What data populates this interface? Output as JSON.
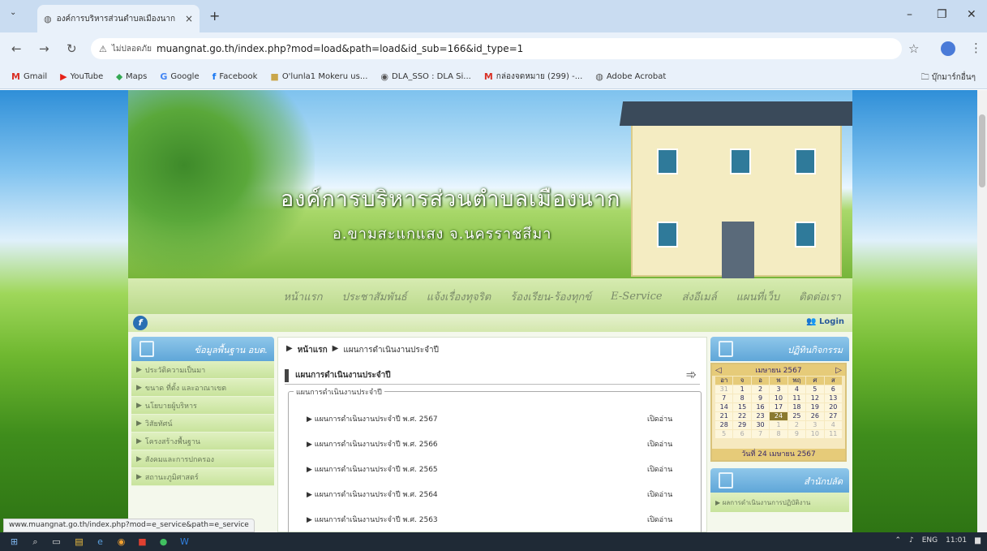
{
  "browser": {
    "tab_title": "องค์การบริหารส่วนตำบลเมืองนาก",
    "not_secure_label": "ไม่ปลอดภัย",
    "url": "muangnat.go.th/index.php?mod=load&path=load&id_sub=166&id_type=1",
    "bookmarks": [
      {
        "icon": "gmail-icon",
        "glyph": "M",
        "label": "Gmail",
        "color": "#d93025"
      },
      {
        "icon": "youtube-icon",
        "glyph": "▶",
        "label": "YouTube",
        "color": "#e62117"
      },
      {
        "icon": "maps-icon",
        "glyph": "⬥",
        "label": "Maps",
        "color": "#34a853"
      },
      {
        "icon": "google-icon",
        "glyph": "G",
        "label": "Google",
        "color": "#4285f4"
      },
      {
        "icon": "facebook-icon",
        "glyph": "f",
        "label": "Facebook",
        "color": "#1877f2"
      },
      {
        "icon": "folder-icon",
        "glyph": "■",
        "label": "O'lunla1 Mokeru us...",
        "color": "#c9a64a"
      },
      {
        "icon": "dla-icon",
        "glyph": "◉",
        "label": "DLA_SSO : DLA Si...",
        "color": "#555555"
      },
      {
        "icon": "gmail-icon",
        "glyph": "M",
        "label": "กล่องจดหมาย (299) -...",
        "color": "#d93025"
      },
      {
        "icon": "globe-icon",
        "glyph": "◍",
        "label": "Adobe Acrobat",
        "color": "#555555"
      }
    ],
    "other_bookmarks": "บุ๊กมาร์กอื่นๆ"
  },
  "site": {
    "title": "องค์การบริหารส่วนตำบลเมืองนาก",
    "subtitle": "อ.ขามสะแกแสง จ.นครราชสีมา",
    "menu": [
      "หน้าแรก",
      "ประชาสัมพันธ์",
      "แจ้งเรื่องทุจริต",
      "ร้องเรียน-ร้องทุกข์",
      "E-Service",
      "ส่งอีเมล์",
      "แผนที่เว็บ",
      "ติดต่อเรา"
    ],
    "login": "Login"
  },
  "left": {
    "title": "ข้อมูลพื้นฐาน อบต.",
    "items": [
      "ประวัติความเป็นมา",
      "ขนาด ที่ตั้ง และอาณาเขต",
      "นโยบายผู้บริหาร",
      "วิสัยทัศน์",
      "โครงสร้างพื้นฐาน",
      "สังคมและการปกครอง",
      "สถานะภูมิศาสตร์"
    ]
  },
  "center": {
    "breadcrumb_home": "หน้าแรก",
    "breadcrumb_current": "แผนการดำเนินงานประจำปี",
    "section_title": "แผนการดำเนินงานประจำปี",
    "fieldset_legend": "แผนการดำเนินงานประจำปี",
    "read_label": "เปิดอ่าน",
    "plans": [
      "แผนการดำเนินงานประจำปี พ.ศ. 2567",
      "แผนการดำเนินงานประจำปี พ.ศ. 2566",
      "แผนการดำเนินงานประจำปี พ.ศ. 2565",
      "แผนการดำเนินงานประจำปี พ.ศ. 2564",
      "แผนการดำเนินงานประจำปี พ.ศ. 2563"
    ]
  },
  "right": {
    "calendar_title": "ปฏิทินกิจกรรม",
    "month_label": "เมษายน 2567",
    "dow": [
      "อา",
      "จ",
      "อ",
      "พ",
      "พฤ",
      "ศ",
      "ส"
    ],
    "weeks": [
      [
        "31",
        "1",
        "2",
        "3",
        "4",
        "5",
        "6"
      ],
      [
        "7",
        "8",
        "9",
        "10",
        "11",
        "12",
        "13"
      ],
      [
        "14",
        "15",
        "16",
        "17",
        "18",
        "19",
        "20"
      ],
      [
        "21",
        "22",
        "23",
        "24",
        "25",
        "26",
        "27"
      ],
      [
        "28",
        "29",
        "30",
        "1",
        "2",
        "3",
        "4"
      ],
      [
        "5",
        "6",
        "7",
        "8",
        "9",
        "10",
        "11"
      ]
    ],
    "today_label": "วันที่ 24 เมษายน 2567",
    "section2_title": "สำนักปลัด",
    "section2_item": "ผลการดำเนินงานการปฏิบัติงาน"
  },
  "status_url": "www.muangnat.go.th/index.php?mod=e_service&path=e_service",
  "taskbar": {
    "lang": "ENG",
    "time": "11:01"
  }
}
